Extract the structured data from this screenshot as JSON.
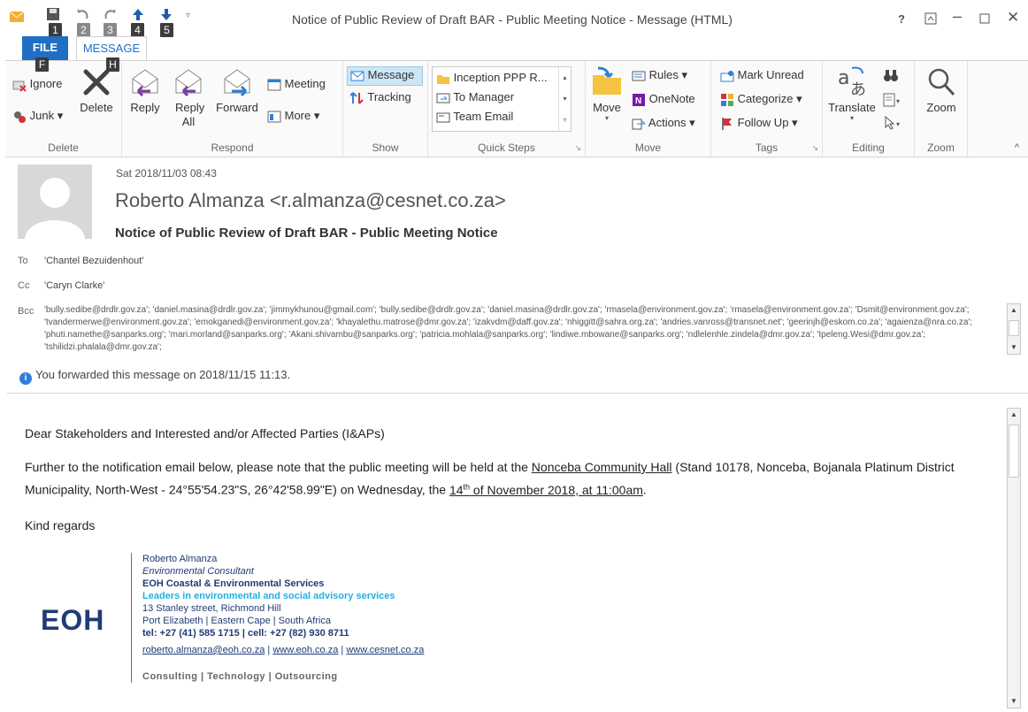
{
  "window": {
    "title": "Notice of Public Review of Draft BAR - Public Meeting Notice - Message (HTML)",
    "help": "?",
    "keytips": [
      "1",
      "2",
      "3",
      "4",
      "5"
    ]
  },
  "tabs": {
    "file": "FILE",
    "message": "MESSAGE",
    "file_keytip": "F",
    "message_keytip": "H"
  },
  "ribbon": {
    "delete": {
      "ignore": "Ignore",
      "junk": "Junk ▾",
      "delete": "Delete",
      "label": "Delete"
    },
    "respond": {
      "reply": "Reply",
      "reply_all": "Reply All",
      "forward": "Forward",
      "meeting": "Meeting",
      "more": "More ▾",
      "label": "Respond"
    },
    "show": {
      "message": "Message",
      "tracking": "Tracking",
      "label": "Show"
    },
    "quick_steps": {
      "items": [
        "Inception PPP R...",
        "To Manager",
        "Team Email"
      ],
      "label": "Quick Steps"
    },
    "move": {
      "move": "Move",
      "rules": "Rules ▾",
      "onenote": "OneNote",
      "actions": "Actions ▾",
      "label": "Move"
    },
    "tags": {
      "mark_unread": "Mark Unread",
      "categorize": "Categorize ▾",
      "follow_up": "Follow Up ▾",
      "label": "Tags"
    },
    "editing": {
      "translate": "Translate",
      "label": "Editing"
    },
    "zoom": {
      "zoom": "Zoom",
      "label": "Zoom"
    }
  },
  "header": {
    "date": "Sat 2018/11/03 08:43",
    "sender": "Roberto Almanza <r.almanza@cesnet.co.za>",
    "subject": "Notice of Public Review of Draft BAR - Public Meeting Notice",
    "to_label": "To",
    "to": "'Chantel Bezuidenhout'",
    "cc_label": "Cc",
    "cc": "'Caryn Clarke'",
    "bcc_label": "Bcc",
    "bcc": "'bully.sedibe@drdlr.gov.za'; 'daniel.masina@drdlr.gov.za'; 'jimmykhunou@gmail.com'; 'bully.sedibe@drdlr.gov.za'; 'daniel.masina@drdlr.gov.za'; 'rmasela@environment.gov.za'; 'rmasela@environment.gov.za'; 'Dsmit@environment.gov.za'; 'tvandermerwe@environment.gov.za'; 'emokganedi@environment.gov.za'; 'khayalethu.matrose@dmr.gov.za'; 'izakvdm@daff.gov.za'; 'nhiggitt@sahra.org.za'; 'andries.vanross@transnet.net'; 'geerinjh@eskom.co.za'; 'agaienza@nra.co.za'; 'phuti.namethe@sanparks.org'; 'mari.morland@sanparks.org'; 'Akani.shivambu@sanparks.org'; 'patricia.mohlala@sanparks.org'; 'lindiwe.mbowane@sanparks.org'; 'ndlelenhle.zindela@dmr.gov.za'; 'Ipeleng.Wesi@dmr.gov.za'; 'tshilidzi.phalala@dmr.gov.za';",
    "forwarded": "You forwarded this message on 2018/11/15 11:13."
  },
  "body": {
    "greeting": "Dear Stakeholders and Interested and/or Affected Parties (I&APs)",
    "p1_start": "Further to the notification email below, please note that the public meeting will be held at the ",
    "p1_venue": "Nonceba Community Hall",
    "p1_mid": " (Stand 10178, Nonceba, Bojanala Platinum District Municipality, North-West - 24°55'54.23\"S, 26°42'58.99\"E) on Wednesday, the ",
    "p1_day": "14",
    "p1_sup": "th",
    "p1_date": " of November 2018, at 11:00am",
    "p1_end": ".",
    "closing": "Kind regards"
  },
  "signature": {
    "logo": "EOH",
    "name": "Roberto Almanza",
    "role": "Environmental Consultant",
    "company": "EOH Coastal & Environmental Services",
    "tagline": "Leaders in environmental and social advisory services",
    "address1": "13 Stanley street, Richmond Hill",
    "address2": "Port Elizabeth  | Eastern Cape  |  South Africa",
    "phone": "tel: +27 (41) 585 1715 | cell: +27 (82) 930 8711",
    "email": "roberto.almanza@eoh.co.za",
    "sep": " | ",
    "web1": "www.eoh.co.za",
    "web2": "www.cesnet.co.za",
    "footer": "Consulting | Technology | Outsourcing"
  }
}
